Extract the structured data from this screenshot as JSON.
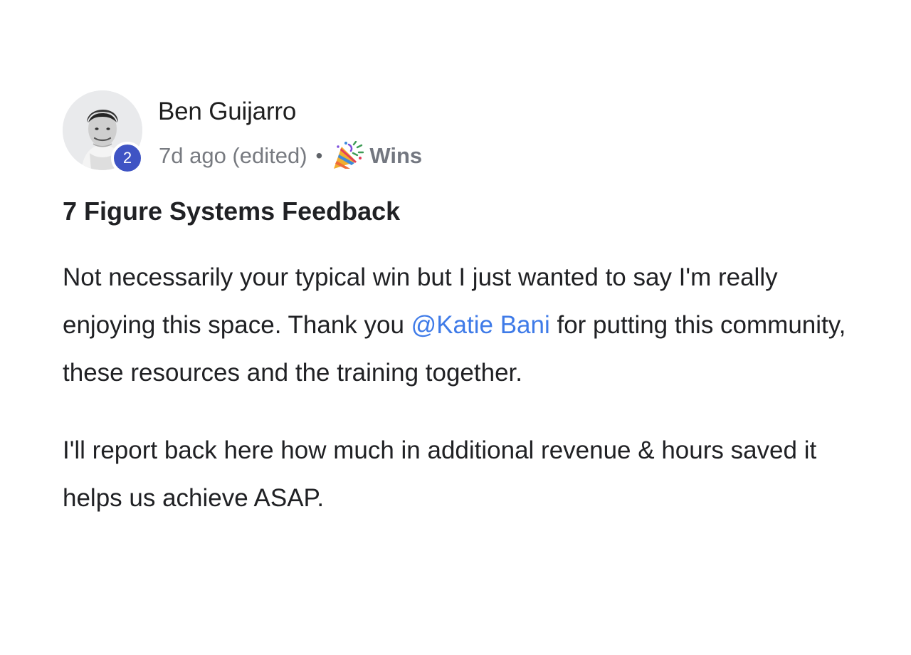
{
  "post": {
    "author": {
      "name": "Ben Guijarro",
      "level": "2"
    },
    "meta": {
      "time": "7d ago (edited)",
      "separator": "•",
      "category": "Wins",
      "category_icon": "party-popper-icon"
    },
    "title": "7 Figure Systems Feedback",
    "body": {
      "paragraph_1": {
        "before_mention": "Not necessarily your typical win but I just wanted to say I'm really enjoying this space. Thank you ",
        "mention": "@Katie Bani",
        "after_mention": " for putting this community, these resources and the training together."
      },
      "paragraph_2": "I'll report back here how much in additional revenue & hours saved it helps us achieve ASAP."
    }
  },
  "colors": {
    "level_badge": "#3f54c4",
    "mention_link": "#3f7be8",
    "meta_text": "#777a80",
    "body_text": "#202124"
  }
}
